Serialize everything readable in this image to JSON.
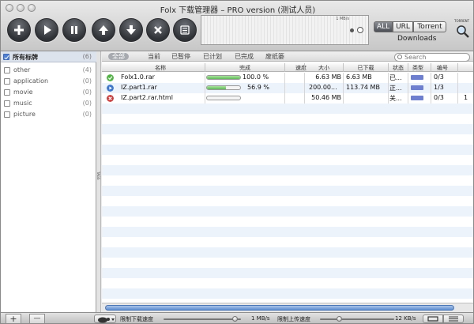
{
  "window": {
    "title": "Folx 下载管理器 – PRO version (测试人员)"
  },
  "toolbar": {
    "buttons": [
      "add",
      "resume",
      "pause",
      "move-up",
      "move-down",
      "delete",
      "task-list"
    ],
    "speed_graph_label": "1 MB/s",
    "segments": [
      "ALL",
      "URL",
      "Torrent"
    ],
    "active_segment": "ALL",
    "segment_caption": "Downloads",
    "torrent_icon_label": "TORRENT"
  },
  "sidebar": {
    "header": {
      "label": "所有标牌",
      "count": "(6)",
      "checked": true
    },
    "items": [
      {
        "label": "other",
        "count": "(4)"
      },
      {
        "label": "application",
        "count": "(0)"
      },
      {
        "label": "movie",
        "count": "(0)"
      },
      {
        "label": "music",
        "count": "(0)"
      },
      {
        "label": "picture",
        "count": "(0)"
      }
    ],
    "splitter_label": "TAGS"
  },
  "filters": {
    "items": [
      "全部",
      "当前",
      "已暂停",
      "已计划",
      "已完成",
      "废纸篓"
    ],
    "active": "全部",
    "search_placeholder": "Search"
  },
  "table": {
    "columns": {
      "name": "名称",
      "progress": "完成",
      "speed": "速度",
      "size": "大小",
      "downloaded": "已下载",
      "status": "状态",
      "type": "类型",
      "number": "编号"
    },
    "rows": [
      {
        "status_icon": "check-icon",
        "name": "Folx1.0.rar",
        "progress": 1.0,
        "progress_label": "100.0 %",
        "speed": "",
        "size": "6.63 MB",
        "downloaded": "6.63 MB",
        "status": "已...",
        "number": "0/3",
        "extra": ""
      },
      {
        "status_icon": "play-icon",
        "name": "IZ.part1.rar",
        "progress": 0.569,
        "progress_label": "56.9 %",
        "speed": "",
        "size": "200.00...",
        "downloaded": "113.74 MB",
        "status": "正...",
        "number": "1/3",
        "extra": ""
      },
      {
        "status_icon": "error-icon",
        "name": "IZ.part2.rar.html",
        "progress": 0.0,
        "progress_label": "",
        "speed": "",
        "size": "50.46 MB",
        "downloaded": "",
        "status": "关...",
        "number": "0/3",
        "extra": "1"
      }
    ]
  },
  "bottombar": {
    "download_limit_label": "限制下载速度",
    "download_limit_value": "1 MB/s",
    "upload_limit_label": "限制上传速度",
    "upload_limit_value": "12 KB/s",
    "add_label": "+",
    "remove_label": "—"
  },
  "colors": {
    "accent": "#4f7fd5",
    "progress": "#60b85a",
    "selected_row": "#edf3fb"
  }
}
